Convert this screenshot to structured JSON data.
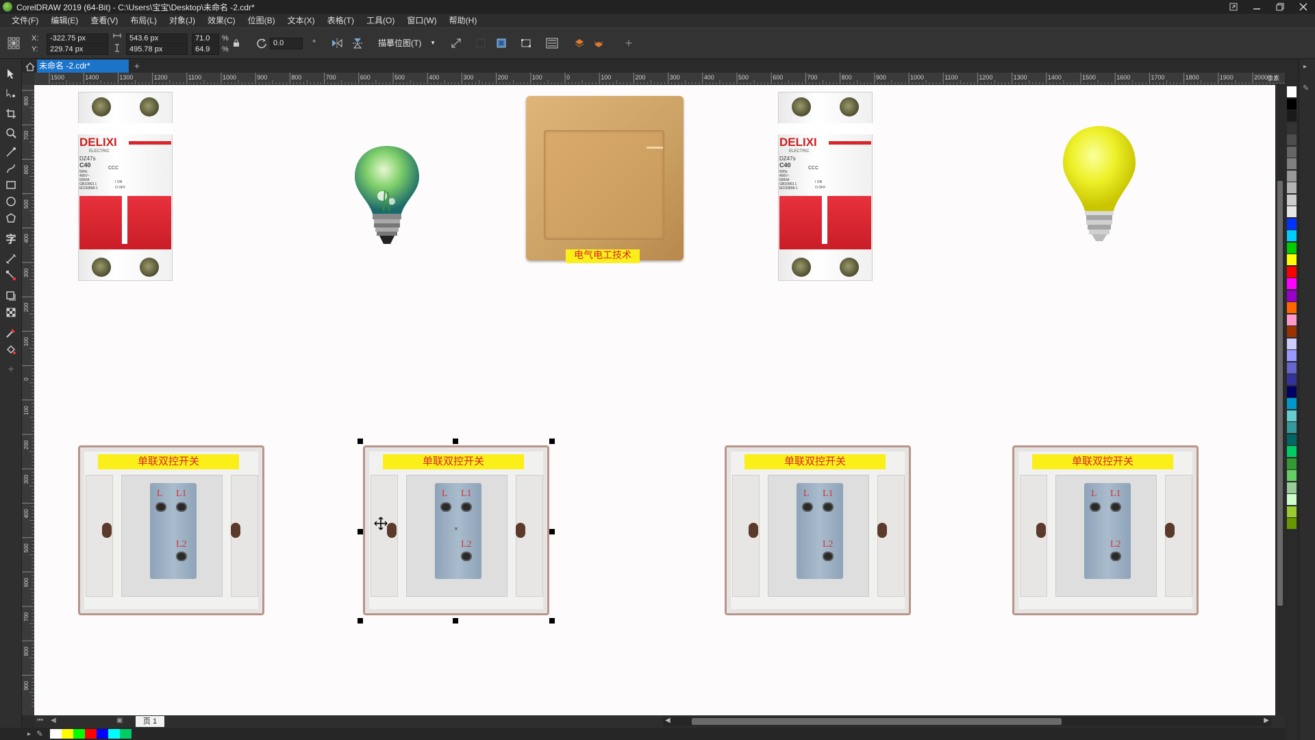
{
  "window": {
    "title": "CorelDRAW 2019 (64-Bit) - C:\\Users\\宝宝\\Desktop\\未命名 -2.cdr*",
    "buttons": [
      "restore-down",
      "minimize",
      "maximize",
      "close"
    ]
  },
  "menu": [
    "文件(F)",
    "编辑(E)",
    "查看(V)",
    "布局(L)",
    "对象(J)",
    "效果(C)",
    "位图(B)",
    "文本(X)",
    "表格(T)",
    "工具(O)",
    "窗口(W)",
    "帮助(H)"
  ],
  "propbar": {
    "x_label": "X:",
    "y_label": "Y:",
    "x_value": "-322.75 px",
    "y_value": "229.74 px",
    "w_value": "543.6 px",
    "h_value": "495.78 px",
    "scale_x": "71.0",
    "scale_y": "64.9",
    "percent": "%",
    "rotation": "0.0",
    "rotation_unit": "°",
    "trace_label": "描摹位图(T)"
  },
  "doc_tab": "未命名 -2.cdr*",
  "page_tab": "页 1",
  "ruler": {
    "h_labels": [
      "1500",
      "1400",
      "1300",
      "1200",
      "1100",
      "1000",
      "900",
      "800",
      "700",
      "600",
      "500",
      "400",
      "300",
      "200",
      "100",
      "0",
      "100",
      "200",
      "300",
      "400",
      "500",
      "600",
      "700",
      "800",
      "900",
      "1000",
      "1100",
      "1200",
      "1300",
      "1400",
      "1500",
      "1600",
      "1700",
      "1800",
      "1900",
      "2000"
    ],
    "h_unit": "像素",
    "v_labels": [
      "800",
      "700",
      "600",
      "500",
      "400",
      "300",
      "200",
      "100",
      "0",
      "100",
      "200",
      "300",
      "400",
      "500",
      "600",
      "700",
      "800",
      "900"
    ]
  },
  "breaker": {
    "brand": "DELIXI",
    "sub": "ELECTRIC",
    "model": "DZ47s",
    "rating": "C40",
    "specs": "50Hz\n400V~\n6000A\nGB10963.1\nIEC60898-1",
    "on": "I ON",
    "off": "O OFF",
    "ccc": "CCC"
  },
  "panel_switch": {
    "label": "电气电工技术"
  },
  "switch_plate": {
    "label": "单联双控开关",
    "term_l": "L",
    "term_l1": "L1",
    "term_l2": "L2"
  },
  "palette_colors": [
    "#ffffff",
    "#000000",
    "#1a1a1a",
    "#333333",
    "#4d4d4d",
    "#666666",
    "#808080",
    "#999999",
    "#b3b3b3",
    "#cccccc",
    "#e6e6e6",
    "#0033ff",
    "#00ccff",
    "#00cc00",
    "#ffff00",
    "#ff0000",
    "#ff00ff",
    "#9900cc",
    "#ff6600",
    "#ff99cc",
    "#993300",
    "#ccccff",
    "#9999ff",
    "#6666cc",
    "#333399",
    "#000066",
    "#0099cc",
    "#66cccc",
    "#339999",
    "#006666",
    "#00cc66",
    "#339933",
    "#66cc66",
    "#99cc99",
    "#ccffcc",
    "#99cc33",
    "#669900"
  ],
  "status_colors": [
    "#ffffff",
    "#ffff00",
    "#00ff00",
    "#ff0000",
    "#0000ff",
    "#00ffff",
    "#00cc66"
  ],
  "accent": "#1b74c9"
}
